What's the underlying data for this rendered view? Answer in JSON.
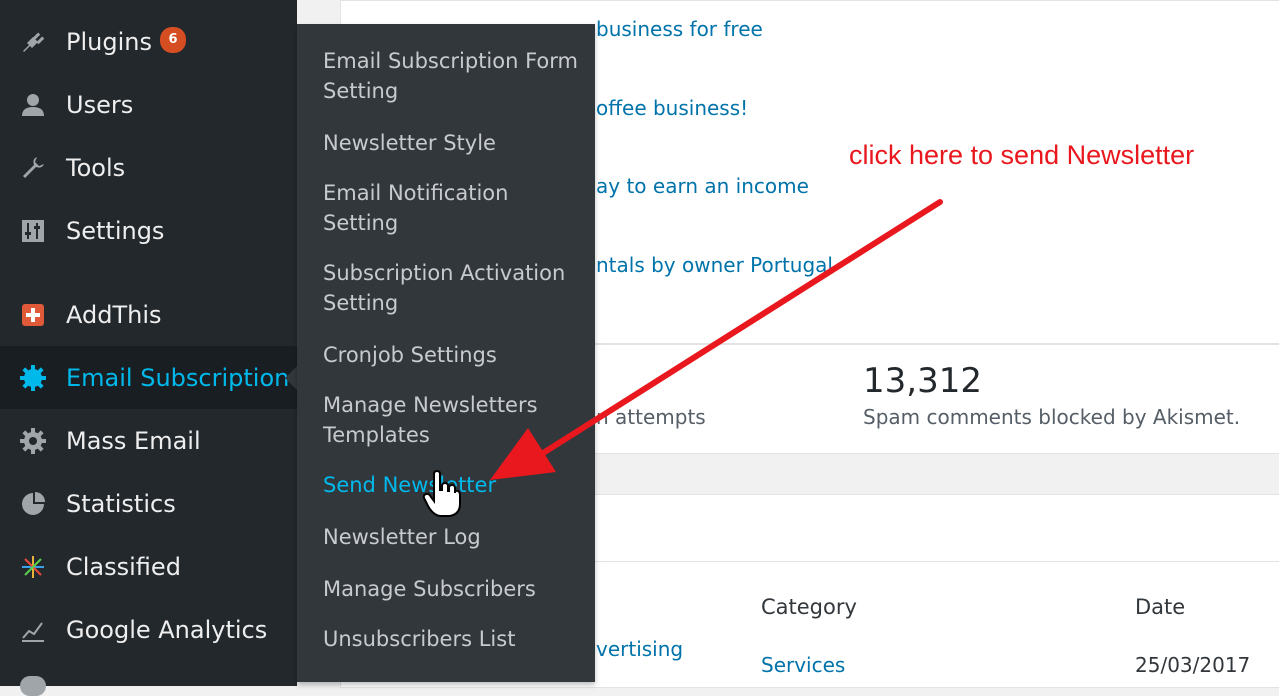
{
  "sidebar": {
    "items": [
      {
        "label": "Plugins",
        "badge": "6",
        "icon": "plugin-icon"
      },
      {
        "label": "Users",
        "icon": "users-icon"
      },
      {
        "label": "Tools",
        "icon": "wrench-icon"
      },
      {
        "label": "Settings",
        "icon": "settings-sliders-icon"
      },
      {
        "label": "AddThis",
        "icon": "addthis-icon"
      },
      {
        "label": "Email Subscription",
        "icon": "gear-icon",
        "current": true
      },
      {
        "label": "Mass Email",
        "icon": "gear-icon"
      },
      {
        "label": "Statistics",
        "icon": "pie-chart-icon"
      },
      {
        "label": "Classified",
        "icon": "classified-icon"
      },
      {
        "label": "Google Analytics",
        "icon": "analytics-icon"
      }
    ]
  },
  "submenu": {
    "items": [
      {
        "label": "Email Subscription Form Setting"
      },
      {
        "label": "Newsletter Style"
      },
      {
        "label": "Email Notification Setting"
      },
      {
        "label": "Subscription Activation Setting"
      },
      {
        "label": "Cronjob Settings"
      },
      {
        "label": "Manage Newsletters Templates"
      },
      {
        "label": "Send Newsletter",
        "active": true
      },
      {
        "label": "Newsletter Log"
      },
      {
        "label": "Manage Subscribers"
      },
      {
        "label": "Unsubscribers List"
      }
    ]
  },
  "main": {
    "links": [
      {
        "text": "business for free"
      },
      {
        "text": "offee business!"
      },
      {
        "text": "ay to earn an income"
      },
      {
        "text": "ntals by owner Portugal"
      }
    ],
    "stats": {
      "left_label": "n attempts",
      "number": "13,312",
      "number_label": "Spam comments blocked by Akismet."
    },
    "table": {
      "headers": {
        "category": "Category",
        "date": "Date"
      },
      "row": {
        "title": "vertising",
        "category": "Services",
        "date": "25/03/2017"
      }
    }
  },
  "annotation": {
    "text": "click here to send Newsletter",
    "color": "#e8181e"
  },
  "colors": {
    "sidebar_bg": "#23282d",
    "submenu_bg": "#32373c",
    "accent": "#00b9eb",
    "badge": "#d54e21",
    "link": "#0073aa"
  }
}
